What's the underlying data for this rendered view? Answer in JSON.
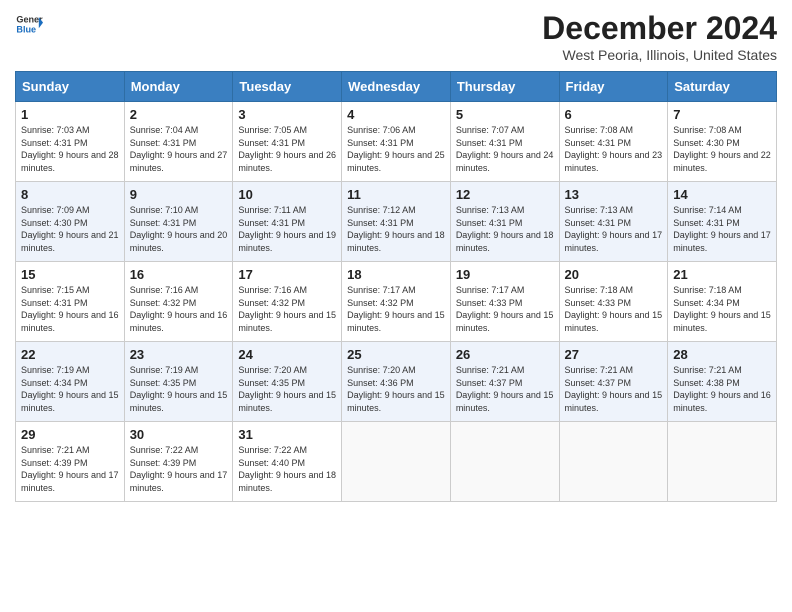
{
  "header": {
    "logo_general": "General",
    "logo_blue": "Blue",
    "month_title": "December 2024",
    "location": "West Peoria, Illinois, United States"
  },
  "days_of_week": [
    "Sunday",
    "Monday",
    "Tuesday",
    "Wednesday",
    "Thursday",
    "Friday",
    "Saturday"
  ],
  "weeks": [
    [
      {
        "day": "1",
        "sunrise": "7:03 AM",
        "sunset": "4:31 PM",
        "daylight": "9 hours and 28 minutes."
      },
      {
        "day": "2",
        "sunrise": "7:04 AM",
        "sunset": "4:31 PM",
        "daylight": "9 hours and 27 minutes."
      },
      {
        "day": "3",
        "sunrise": "7:05 AM",
        "sunset": "4:31 PM",
        "daylight": "9 hours and 26 minutes."
      },
      {
        "day": "4",
        "sunrise": "7:06 AM",
        "sunset": "4:31 PM",
        "daylight": "9 hours and 25 minutes."
      },
      {
        "day": "5",
        "sunrise": "7:07 AM",
        "sunset": "4:31 PM",
        "daylight": "9 hours and 24 minutes."
      },
      {
        "day": "6",
        "sunrise": "7:08 AM",
        "sunset": "4:31 PM",
        "daylight": "9 hours and 23 minutes."
      },
      {
        "day": "7",
        "sunrise": "7:08 AM",
        "sunset": "4:30 PM",
        "daylight": "9 hours and 22 minutes."
      }
    ],
    [
      {
        "day": "8",
        "sunrise": "7:09 AM",
        "sunset": "4:30 PM",
        "daylight": "9 hours and 21 minutes."
      },
      {
        "day": "9",
        "sunrise": "7:10 AM",
        "sunset": "4:31 PM",
        "daylight": "9 hours and 20 minutes."
      },
      {
        "day": "10",
        "sunrise": "7:11 AM",
        "sunset": "4:31 PM",
        "daylight": "9 hours and 19 minutes."
      },
      {
        "day": "11",
        "sunrise": "7:12 AM",
        "sunset": "4:31 PM",
        "daylight": "9 hours and 18 minutes."
      },
      {
        "day": "12",
        "sunrise": "7:13 AM",
        "sunset": "4:31 PM",
        "daylight": "9 hours and 18 minutes."
      },
      {
        "day": "13",
        "sunrise": "7:13 AM",
        "sunset": "4:31 PM",
        "daylight": "9 hours and 17 minutes."
      },
      {
        "day": "14",
        "sunrise": "7:14 AM",
        "sunset": "4:31 PM",
        "daylight": "9 hours and 17 minutes."
      }
    ],
    [
      {
        "day": "15",
        "sunrise": "7:15 AM",
        "sunset": "4:31 PM",
        "daylight": "9 hours and 16 minutes."
      },
      {
        "day": "16",
        "sunrise": "7:16 AM",
        "sunset": "4:32 PM",
        "daylight": "9 hours and 16 minutes."
      },
      {
        "day": "17",
        "sunrise": "7:16 AM",
        "sunset": "4:32 PM",
        "daylight": "9 hours and 15 minutes."
      },
      {
        "day": "18",
        "sunrise": "7:17 AM",
        "sunset": "4:32 PM",
        "daylight": "9 hours and 15 minutes."
      },
      {
        "day": "19",
        "sunrise": "7:17 AM",
        "sunset": "4:33 PM",
        "daylight": "9 hours and 15 minutes."
      },
      {
        "day": "20",
        "sunrise": "7:18 AM",
        "sunset": "4:33 PM",
        "daylight": "9 hours and 15 minutes."
      },
      {
        "day": "21",
        "sunrise": "7:18 AM",
        "sunset": "4:34 PM",
        "daylight": "9 hours and 15 minutes."
      }
    ],
    [
      {
        "day": "22",
        "sunrise": "7:19 AM",
        "sunset": "4:34 PM",
        "daylight": "9 hours and 15 minutes."
      },
      {
        "day": "23",
        "sunrise": "7:19 AM",
        "sunset": "4:35 PM",
        "daylight": "9 hours and 15 minutes."
      },
      {
        "day": "24",
        "sunrise": "7:20 AM",
        "sunset": "4:35 PM",
        "daylight": "9 hours and 15 minutes."
      },
      {
        "day": "25",
        "sunrise": "7:20 AM",
        "sunset": "4:36 PM",
        "daylight": "9 hours and 15 minutes."
      },
      {
        "day": "26",
        "sunrise": "7:21 AM",
        "sunset": "4:37 PM",
        "daylight": "9 hours and 15 minutes."
      },
      {
        "day": "27",
        "sunrise": "7:21 AM",
        "sunset": "4:37 PM",
        "daylight": "9 hours and 15 minutes."
      },
      {
        "day": "28",
        "sunrise": "7:21 AM",
        "sunset": "4:38 PM",
        "daylight": "9 hours and 16 minutes."
      }
    ],
    [
      {
        "day": "29",
        "sunrise": "7:21 AM",
        "sunset": "4:39 PM",
        "daylight": "9 hours and 17 minutes."
      },
      {
        "day": "30",
        "sunrise": "7:22 AM",
        "sunset": "4:39 PM",
        "daylight": "9 hours and 17 minutes."
      },
      {
        "day": "31",
        "sunrise": "7:22 AM",
        "sunset": "4:40 PM",
        "daylight": "9 hours and 18 minutes."
      },
      null,
      null,
      null,
      null
    ]
  ],
  "labels": {
    "sunrise": "Sunrise:",
    "sunset": "Sunset:",
    "daylight": "Daylight:"
  }
}
